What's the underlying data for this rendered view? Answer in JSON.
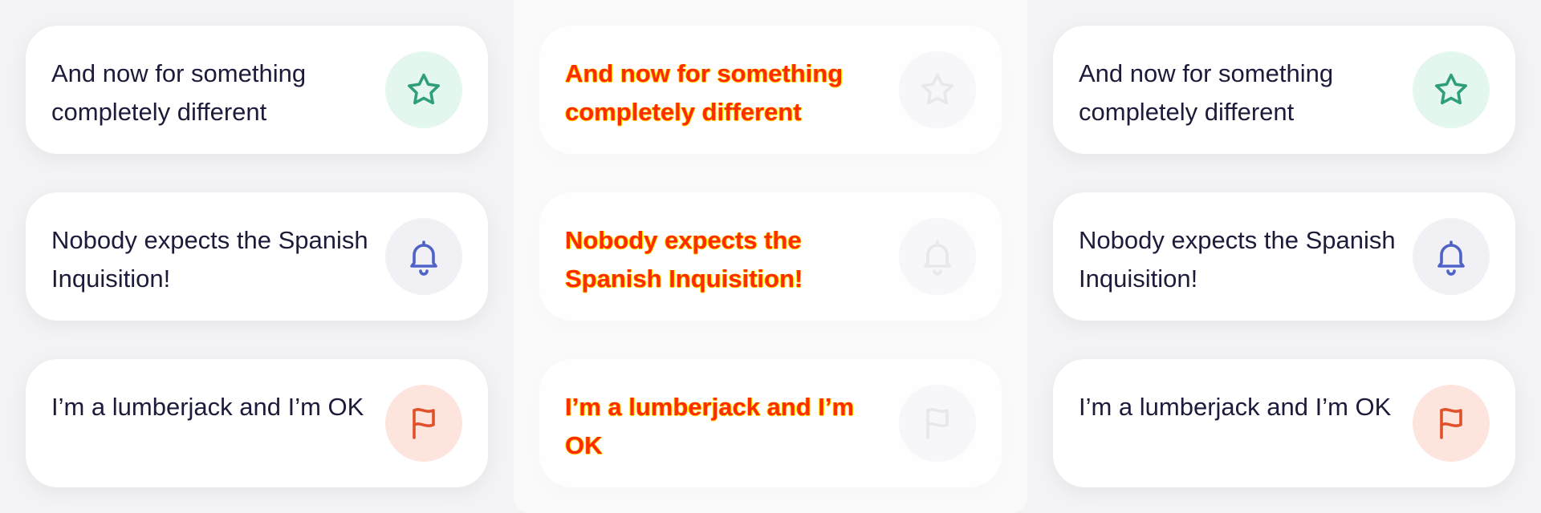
{
  "columns": [
    {
      "cards": [
        {
          "text": "And now for something completely different",
          "icon": "star-icon",
          "badge_color": "#e4f7ef",
          "icon_color": "#2f9e7a"
        },
        {
          "text": "Nobody expects the Spanish Inquisition!",
          "icon": "bell-icon",
          "badge_color": "#f1f1f5",
          "icon_color": "#4f62c9"
        },
        {
          "text": "I’m a lumberjack and I’m OK",
          "icon": "flag-icon",
          "badge_color": "#fde5de",
          "icon_color": "#e0502a"
        }
      ]
    },
    {
      "cards": [
        {
          "text": "And now for something completely different",
          "icon": "star-icon"
        },
        {
          "text": "Nobody expects the Spanish Inquisition!",
          "icon": "bell-icon"
        },
        {
          "text": "I’m a lumberjack and I’m OK",
          "icon": "flag-icon"
        }
      ]
    },
    {
      "cards": [
        {
          "text": "And now for something completely different",
          "icon": "star-icon",
          "badge_color": "#e4f7ef",
          "icon_color": "#2f9e7a"
        },
        {
          "text": "Nobody expects the Spanish Inquisition!",
          "icon": "bell-icon",
          "badge_color": "#f1f1f5",
          "icon_color": "#4f62c9"
        },
        {
          "text": "I’m a lumberjack and I’m OK",
          "icon": "flag-icon",
          "badge_color": "#fde5de",
          "icon_color": "#e0502a"
        }
      ]
    }
  ]
}
